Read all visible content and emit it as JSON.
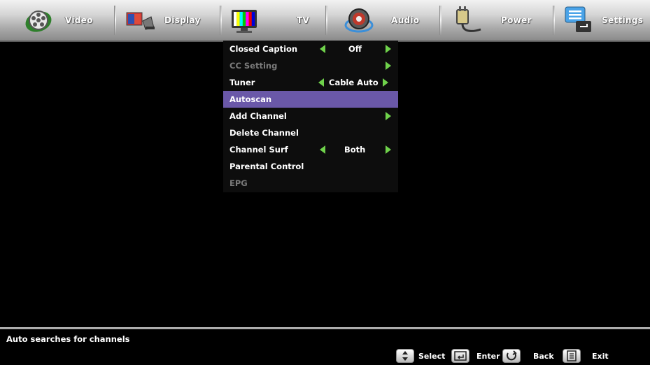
{
  "tabs": [
    {
      "label": "Video",
      "icon": "film-reel-icon"
    },
    {
      "label": "Display",
      "icon": "display-icon"
    },
    {
      "label": "TV",
      "icon": "tv-icon",
      "active": true
    },
    {
      "label": "Audio",
      "icon": "speaker-icon"
    },
    {
      "label": "Power",
      "icon": "power-plug-icon"
    },
    {
      "label": "Settings",
      "icon": "settings-icon"
    }
  ],
  "menu": {
    "items": [
      {
        "label": "Closed Caption",
        "value": "Off",
        "enabled": true
      },
      {
        "label": "CC Setting",
        "value": "",
        "enabled": false
      },
      {
        "label": "Tuner",
        "value": "Cable Auto",
        "enabled": true
      },
      {
        "label": "Autoscan",
        "value": "",
        "enabled": true,
        "selected": true
      },
      {
        "label": "Add Channel",
        "value": "",
        "enabled": true
      },
      {
        "label": "Delete Channel",
        "value": "",
        "enabled": true
      },
      {
        "label": "Channel Surf",
        "value": "Both",
        "enabled": true
      },
      {
        "label": "Parental Control",
        "value": "",
        "enabled": true
      },
      {
        "label": "EPG",
        "value": "",
        "enabled": false
      }
    ]
  },
  "status": {
    "help_text": "Auto searches for channels"
  },
  "hints": [
    {
      "label": "Select",
      "icon": "up-down-arrows-icon"
    },
    {
      "label": "Enter",
      "icon": "enter-key-icon"
    },
    {
      "label": "Back",
      "icon": "back-arrow-icon"
    },
    {
      "label": "Exit",
      "icon": "exit-icon"
    }
  ],
  "colors": {
    "selection": "#6a58a8",
    "arrow": "#6fd24b",
    "disabled_text": "#7a7a7a"
  }
}
